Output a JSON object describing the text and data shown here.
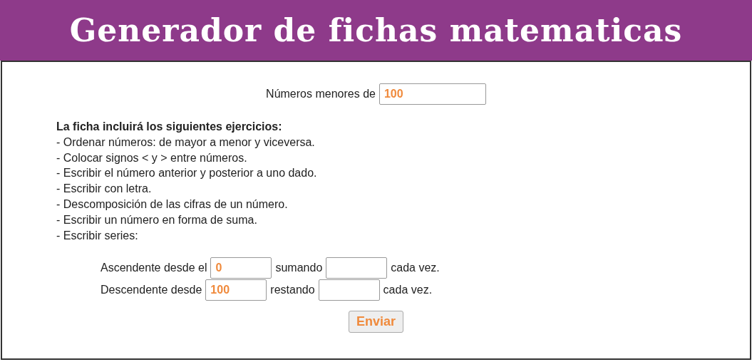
{
  "header": {
    "title": "Generador de fichas matematicas"
  },
  "limit": {
    "label": "Números menores de",
    "value": "100"
  },
  "exercises": {
    "heading": "La ficha incluirá los siguientes ejercicios:",
    "items": [
      "- Ordenar números: de mayor a menor y viceversa.",
      "- Colocar signos < y > entre números.",
      "- Escribir el número anterior y posterior a uno dado.",
      "- Escribir con letra.",
      "- Descomposición de las cifras de un número.",
      "- Escribir un número en forma de suma.",
      "- Escribir series:"
    ]
  },
  "series": [
    {
      "start_label": "Ascendente desde el",
      "start_value": "0",
      "step_label": "sumando",
      "suffix": "cada vez."
    },
    {
      "start_label": "Descendente desde",
      "start_value": "100",
      "step_label": "restando",
      "suffix": "cada vez."
    }
  ],
  "submit": {
    "label": "Enviar"
  }
}
